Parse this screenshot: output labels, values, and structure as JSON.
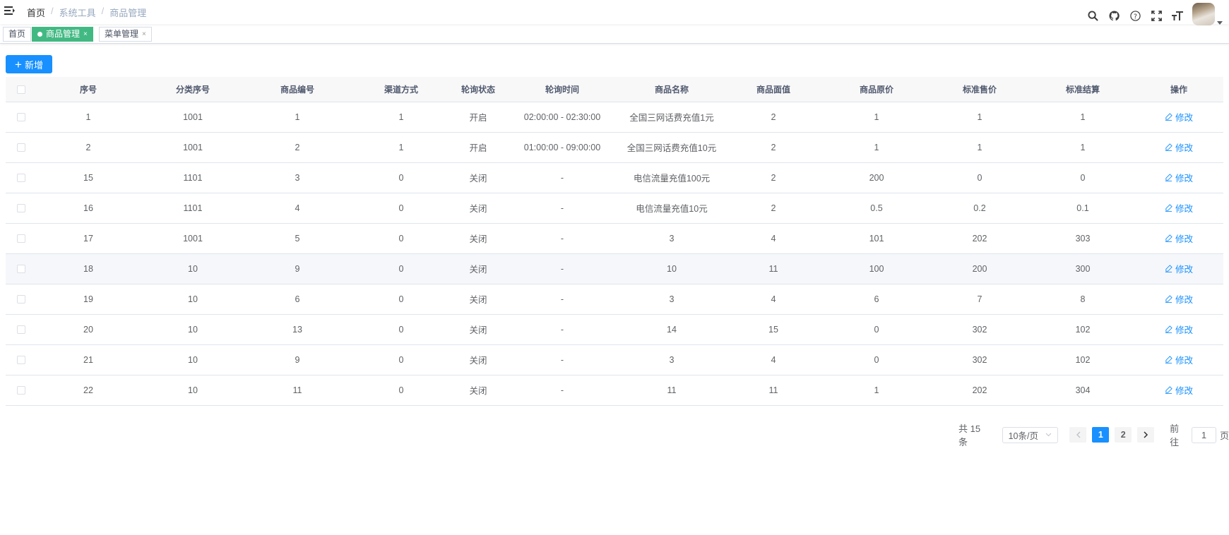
{
  "navbar": {
    "breadcrumb": [
      "首页",
      "系统工具",
      "商品管理"
    ],
    "breadcrumb_sep": "/",
    "icons": [
      "search-icon",
      "github-icon",
      "help-icon",
      "fullscreen-icon",
      "font-size-icon"
    ]
  },
  "tags": [
    {
      "label": "首页",
      "active": false,
      "closable": false
    },
    {
      "label": "商品管理",
      "active": true,
      "closable": true
    },
    {
      "label": "菜单管理",
      "active": false,
      "closable": true
    }
  ],
  "tag_close": "×",
  "toolbar": {
    "add_label": "新增",
    "add_icon": "+"
  },
  "table": {
    "columns": [
      "序号",
      "分类序号",
      "商品编号",
      "渠道方式",
      "轮询状态",
      "轮询时间",
      "商品名称",
      "商品面值",
      "商品原价",
      "标准售价",
      "标准结算",
      "操作"
    ],
    "edit_label": "修改",
    "rows": [
      [
        "1",
        "1001",
        "1",
        "1",
        "开启",
        "02:00:00 - 02:30:00",
        "全国三网话费充值1元",
        "2",
        "1",
        "1",
        "1"
      ],
      [
        "2",
        "1001",
        "2",
        "1",
        "开启",
        "01:00:00 - 09:00:00",
        "全国三网话费充值10元",
        "2",
        "1",
        "1",
        "1"
      ],
      [
        "15",
        "1101",
        "3",
        "0",
        "关闭",
        "-",
        "电信流量充值100元",
        "2",
        "200",
        "0",
        "0"
      ],
      [
        "16",
        "1101",
        "4",
        "0",
        "关闭",
        "-",
        "电信流量充值10元",
        "2",
        "0.5",
        "0.2",
        "0.1"
      ],
      [
        "17",
        "1001",
        "5",
        "0",
        "关闭",
        "-",
        "3",
        "4",
        "101",
        "202",
        "303"
      ],
      [
        "18",
        "10",
        "9",
        "0",
        "关闭",
        "-",
        "10",
        "11",
        "100",
        "200",
        "300"
      ],
      [
        "19",
        "10",
        "6",
        "0",
        "关闭",
        "-",
        "3",
        "4",
        "6",
        "7",
        "8"
      ],
      [
        "20",
        "10",
        "13",
        "0",
        "关闭",
        "-",
        "14",
        "15",
        "0",
        "302",
        "102"
      ],
      [
        "21",
        "10",
        "9",
        "0",
        "关闭",
        "-",
        "3",
        "4",
        "0",
        "302",
        "102"
      ],
      [
        "22",
        "10",
        "11",
        "0",
        "关闭",
        "-",
        "11",
        "11",
        "1",
        "202",
        "304"
      ]
    ],
    "hover_row": 5
  },
  "pagination": {
    "total_label": "共 15 条",
    "page_size": "10条/页",
    "pages": [
      "1",
      "2"
    ],
    "current_page": "1",
    "goto_label": "前往",
    "goto_value": "1",
    "page_suffix": "页"
  },
  "colors": {
    "primary": "#1890ff",
    "tag_active": "#42b983"
  }
}
